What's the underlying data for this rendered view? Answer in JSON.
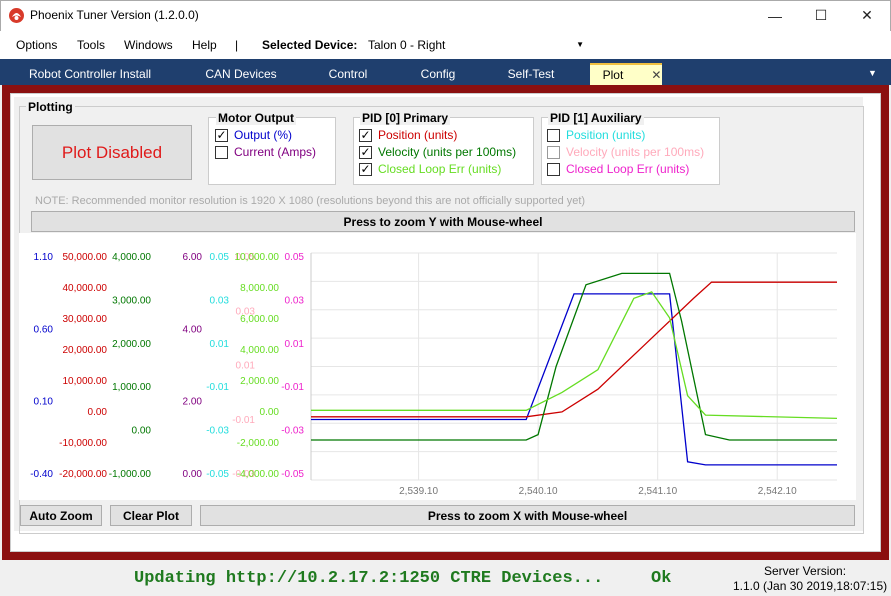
{
  "window": {
    "title": "Phoenix Tuner Version (1.2.0.0)",
    "minimize": "—",
    "maximize": "☐",
    "close": "✕"
  },
  "menu": {
    "items": [
      "Options",
      "Tools",
      "Windows",
      "Help",
      "|"
    ],
    "selected_device_label": "Selected Device:",
    "selected_device_value": "Talon 0 -  Right"
  },
  "tabs": [
    {
      "label": "Robot Controller Install"
    },
    {
      "label": "CAN Devices"
    },
    {
      "label": "Control"
    },
    {
      "label": "Config"
    },
    {
      "label": "Self-Test"
    },
    {
      "label": "Plot",
      "active": true
    }
  ],
  "tab_close": "✕",
  "tab_overflow": "▼",
  "plotting": {
    "title": "Plotting",
    "plot_disabled_label": "Plot Disabled",
    "motor_output": {
      "title": "Motor Output",
      "items": [
        {
          "label": "Output (%)",
          "checked": true,
          "color": "#0000cc"
        },
        {
          "label": "Current (Amps)",
          "checked": false,
          "color": "#800080"
        }
      ]
    },
    "pid0": {
      "title": "PID [0] Primary",
      "items": [
        {
          "label": "Position (units)",
          "checked": true,
          "color": "#cc0000"
        },
        {
          "label": "Velocity (units per 100ms)",
          "checked": true,
          "color": "#007700"
        },
        {
          "label": "Closed Loop Err (units)",
          "checked": true,
          "color": "#66dd22"
        }
      ]
    },
    "pid1": {
      "title": "PID [1] Auxiliary",
      "items": [
        {
          "label": "Position (units)",
          "checked": false,
          "color": "#22dddd"
        },
        {
          "label": "Velocity (units per 100ms)",
          "checked": false,
          "color": "#ffaabb"
        },
        {
          "label": "Closed Loop Err (units)",
          "checked": false,
          "color": "#ee22cc"
        }
      ]
    },
    "note": "NOTE: Recommended monitor resolution is 1920 X 1080 (resolutions beyond this are not officially supported yet)",
    "zoom_y_label": "Press to zoom Y with Mouse-wheel",
    "zoom_x_label": "Press to zoom X with Mouse-wheel",
    "auto_zoom_label": "Auto Zoom",
    "clear_plot_label": "Clear Plot"
  },
  "chart_data": {
    "type": "line",
    "x_ticks": [
      2539.1,
      2540.1,
      2541.1,
      2542.1
    ],
    "x_tick_labels": [
      "2,539.10",
      "2,540.10",
      "2,541.10",
      "2,542.10"
    ],
    "xlim": [
      2538.2,
      2542.6
    ],
    "axes": [
      {
        "name": "output",
        "color": "#0000cc",
        "ticks": [
          "1.10",
          "0.60",
          "0.10",
          "-0.40"
        ],
        "ylim": [
          -0.4,
          1.1
        ]
      },
      {
        "name": "position",
        "color": "#cc0000",
        "ticks": [
          "50,000.00",
          "40,000.00",
          "30,000.00",
          "20,000.00",
          "10,000.00",
          "0.00",
          "-10,000.00",
          "-20,000.00"
        ],
        "ylim": [
          -20000,
          50000
        ]
      },
      {
        "name": "velocity",
        "color": "#007700",
        "ticks": [
          "4,000.00",
          "3,000.00",
          "2,000.00",
          "1,000.00",
          "0.00",
          "-1,000.00"
        ],
        "ylim": [
          -1000,
          4000
        ]
      },
      {
        "name": "current",
        "color": "#800080",
        "ticks": [
          "6.00",
          "4.00",
          "2.00",
          "0.00"
        ],
        "ylim": [
          0,
          6
        ]
      },
      {
        "name": "pid1-position",
        "color": "#22dddd",
        "ticks": [
          "0.05",
          "0.03",
          "0.01",
          "-0.01",
          "-0.03",
          "-0.05"
        ],
        "ylim": [
          -0.05,
          0.05
        ]
      },
      {
        "name": "pid1-velocity",
        "color": "#ffaabb",
        "ticks": [
          "0.05",
          "0.03",
          "0.01",
          "-0.01",
          "-0.03"
        ],
        "ylim": [
          -0.05,
          0.05
        ]
      },
      {
        "name": "closed-loop-err",
        "color": "#66dd22",
        "ticks": [
          "10,000.00",
          "8,000.00",
          "6,000.00",
          "4,000.00",
          "2,000.00",
          "0.00",
          "-2,000.00",
          "-4,000.00"
        ],
        "ylim": [
          -4000,
          10000
        ]
      },
      {
        "name": "pid1-err",
        "color": "#ee22cc",
        "ticks": [
          "0.05",
          "0.03",
          "0.01",
          "-0.01",
          "-0.03",
          "-0.05"
        ],
        "ylim": [
          -0.05,
          0.05
        ]
      }
    ],
    "series": [
      {
        "axis": "output",
        "color": "#0000cc",
        "x": [
          2538.2,
          2540.0,
          2540.4,
          2541.2,
          2541.35,
          2541.5,
          2542.6
        ],
        "y": [
          0.0,
          0.0,
          0.83,
          0.83,
          -0.28,
          -0.3,
          -0.3
        ]
      },
      {
        "axis": "position",
        "color": "#cc0000",
        "x": [
          2538.2,
          2540.0,
          2540.3,
          2540.6,
          2541.0,
          2541.4,
          2541.55,
          2542.6
        ],
        "y": [
          -500,
          -500,
          1000,
          8000,
          22000,
          36000,
          41000,
          41000
        ]
      },
      {
        "axis": "velocity",
        "color": "#007700",
        "x": [
          2538.2,
          2540.0,
          2540.1,
          2540.25,
          2540.5,
          2540.8,
          2541.2,
          2541.3,
          2541.5,
          2541.7,
          2542.6
        ],
        "y": [
          -120,
          -120,
          0,
          1500,
          3300,
          3550,
          3550,
          2500,
          0,
          -120,
          -120
        ]
      },
      {
        "axis": "closed-loop-err",
        "color": "#66dd22",
        "x": [
          2538.2,
          2540.0,
          2540.3,
          2540.6,
          2540.9,
          2541.05,
          2541.2,
          2541.35,
          2541.5,
          2542.6
        ],
        "y": [
          300,
          300,
          1400,
          2800,
          7200,
          7600,
          6000,
          1200,
          0,
          -200
        ]
      }
    ]
  },
  "status": {
    "text": "Updating http://10.2.17.2:1250 CTRE Devices...",
    "ok": "Ok",
    "server_version_label": "Server Version:",
    "server_version_value": "1.1.0 (Jan 30 2019,18:07:15)"
  }
}
